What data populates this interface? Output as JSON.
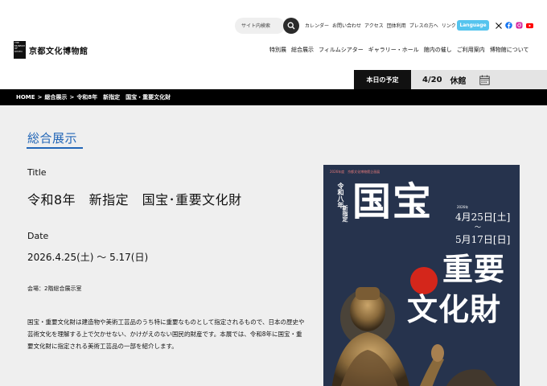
{
  "header": {
    "search_placeholder": "サイト内検索",
    "util_links": [
      "カレンダー",
      "お問い合わせ",
      "アクセス",
      "団体利用",
      "プレスの方へ",
      "リンク"
    ],
    "language_label": "Language",
    "social_icons": [
      "x-icon",
      "facebook-icon",
      "instagram-icon",
      "youtube-icon"
    ],
    "logo_mark": "THE MUSEUM OF KYOTO",
    "logo_text": "京都文化博物館",
    "nav": [
      "特別展",
      "総合展示",
      "フィルムシアター",
      "ギャラリー・ホール",
      "館内の催し",
      "ご利用案内",
      "博物館について"
    ]
  },
  "schedule": {
    "label": "本日の予定",
    "date": "4/20",
    "status": "休館"
  },
  "breadcrumb": [
    "HOME",
    ">",
    "総合展示",
    ">",
    "令和8年　新指定　国宝・重要文化財"
  ],
  "main": {
    "section_title": "総合展示",
    "title_label": "Title",
    "title": "令和8年　新指定　国宝･重要文化財",
    "date_label": "Date",
    "date": "2026.4.25(土) ～ 5.17(日)",
    "venue": "会場：2階総合展示室",
    "description": "国宝・重要文化財は建造物や美術工芸品のうち特に重要なものとして指定されるもので、日本の歴史や芸術文化を理解する上で欠かせない、かけがえのない国民的財産です。本展では、令和8年に国宝・重要文化財に指定される美術工芸品の一部を紹介します。"
  },
  "poster": {
    "top_text": "2026年度　京都文化博物館企画展",
    "vertical_text": "令和八年",
    "sub_text": "新指定",
    "kokuho": "国宝",
    "year": "2026年",
    "date_start": "4月25日[土]",
    "tilde": "～",
    "date_end": "5月17日[日]",
    "juyo": "重要",
    "bunkazai": "文化財"
  },
  "colors": {
    "accent": "#2266b7",
    "language_button": "#55c4ee",
    "poster_bg": "#26334d",
    "poster_dot": "#d4261b"
  }
}
